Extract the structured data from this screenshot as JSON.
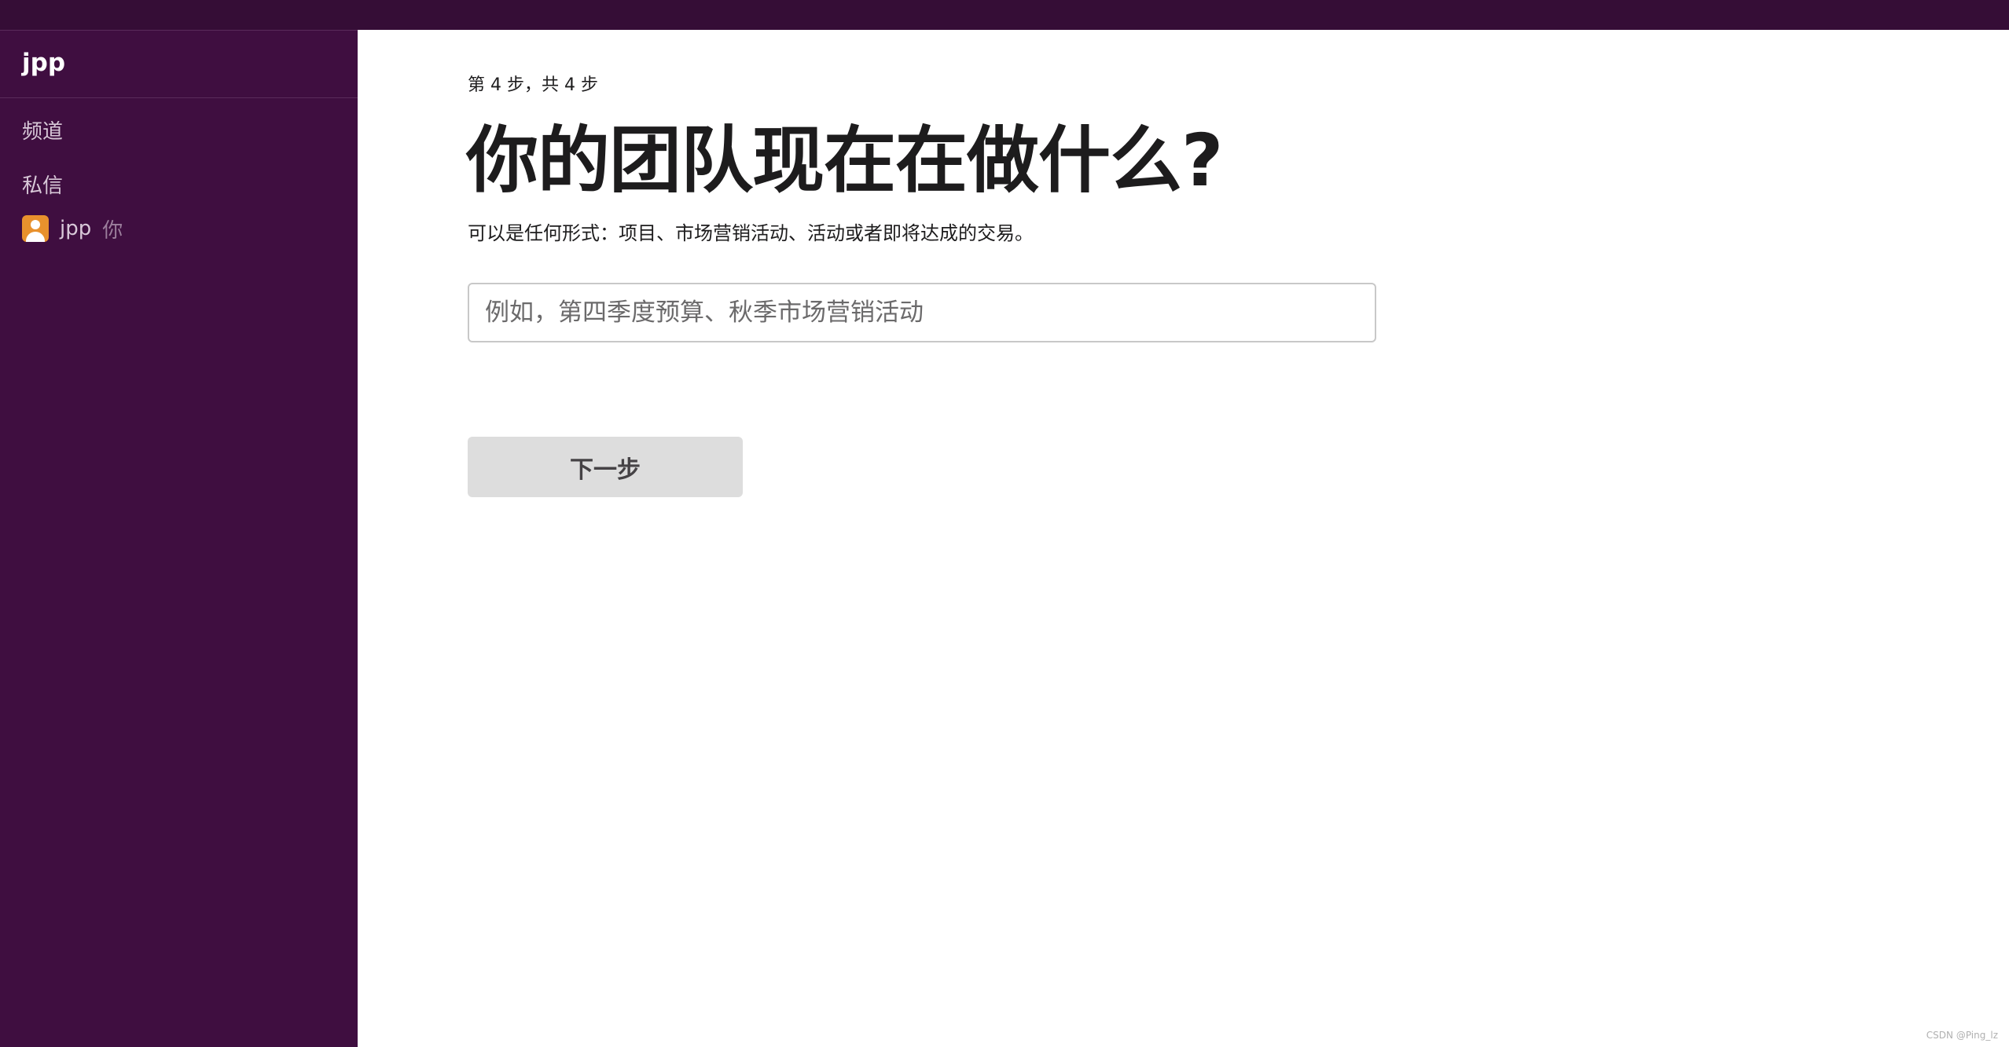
{
  "sidebar": {
    "workspace_name": "jpp",
    "channels_label": "频道",
    "dms_label": "私信",
    "dm_items": [
      {
        "name": "jpp",
        "suffix": "你",
        "avatar_icon": "user-avatar-icon"
      }
    ]
  },
  "main": {
    "step_text": "第 4 步，共 4 步",
    "title": "你的团队现在在做什么?",
    "subtitle": "可以是任何形式：项目、市场营销活动、活动或者即将达成的交易。",
    "input": {
      "value": "",
      "placeholder": "例如，第四季度预算、秋季市场营销活动"
    },
    "next_button_label": "下一步"
  },
  "watermark": "CSDN @Ping_lz",
  "colors": {
    "topbar": "#350d36",
    "sidebar": "#3f0e40",
    "avatar": "#e8912d",
    "button_bg": "#dddddd",
    "text": "#1d1c1d"
  }
}
